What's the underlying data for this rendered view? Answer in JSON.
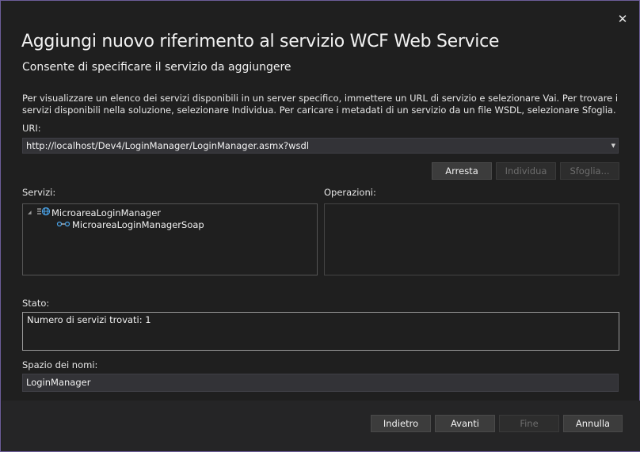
{
  "dialog": {
    "close_glyph": "✕",
    "title": "Aggiungi nuovo riferimento al servizio WCF Web Service",
    "subtitle": "Consente di specificare il servizio da aggiungere",
    "description": "Per visualizzare un elenco dei servizi disponibili in un server specifico, immettere un URL di servizio e selezionare Vai. Per trovare i servizi disponibili nella soluzione, selezionare Individua. Per caricare i metadati di un servizio da un file WSDL, selezionare Sfoglia."
  },
  "uri": {
    "label": "URI:",
    "value": "http://localhost/Dev4/LoginManager/LoginManager.asmx?wsdl"
  },
  "actions": {
    "arresta": "Arresta",
    "individua": "Individua",
    "sfoglia": "Sfoglia..."
  },
  "services": {
    "label": "Servizi:",
    "tree": [
      {
        "label": "MicroareaLoginManager",
        "icon": "web-service-icon",
        "expanded": true
      },
      {
        "label": "MicroareaLoginManagerSoap",
        "icon": "endpoint-icon"
      }
    ]
  },
  "operations": {
    "label": "Operazioni:"
  },
  "status": {
    "label": "Stato:",
    "text": "Numero di servizi trovati: 1"
  },
  "namespace": {
    "label": "Spazio dei nomi:",
    "value": "LoginManager"
  },
  "footer": {
    "back": "Indietro",
    "next": "Avanti",
    "finish": "Fine",
    "cancel": "Annulla"
  },
  "colors": {
    "accent_border": "#6c5d99",
    "background": "#1f1f1f",
    "footer_bg": "#252526",
    "globe_blue": "#4aa3e8"
  }
}
